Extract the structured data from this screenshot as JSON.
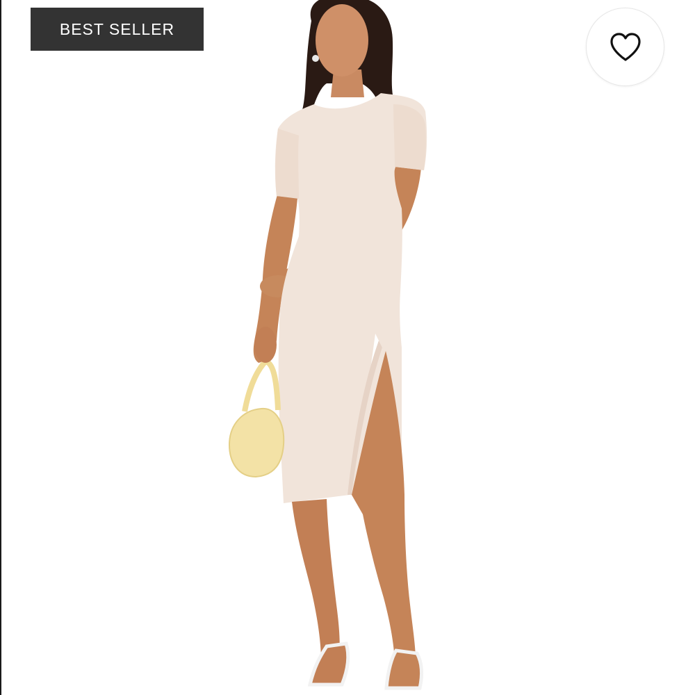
{
  "badge": {
    "label": "BEST SELLER"
  },
  "favorite": {
    "icon": "heart-outline-icon"
  },
  "colors": {
    "badge_bg": "#333333",
    "badge_text": "#ffffff",
    "dress": "#f1e4da",
    "skin": "#c98a62",
    "hair": "#2a1a14",
    "bag": "#f3e2a6",
    "page_bg": "#ffffff"
  }
}
